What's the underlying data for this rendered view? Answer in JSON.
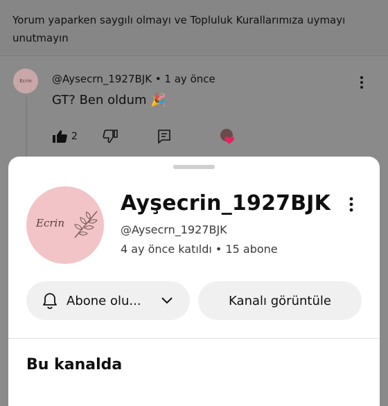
{
  "notice": {
    "text": "Yorum yaparken saygılı olmayı ve Topluluk Kurallarımıza uymayı unutmayın"
  },
  "comment": {
    "avatar_text": "Ecrin",
    "meta": "@Aysecrn_1927BJK • 1 ay önce",
    "text": "GT? Ben oldum 🎉",
    "like_count": "2",
    "icons": [
      "like-icon",
      "dislike-icon",
      "reply-icon",
      "creator-heart-icon",
      "more-vert-icon"
    ]
  },
  "sheet": {
    "avatar_text": "Ecrin",
    "title": "Ayşecrin_1927BJK",
    "handle": "@Aysecrn_1927BJK",
    "info": "4 ay önce katıldı • 15 abone",
    "subscribe_label": "Abone olu...",
    "view_channel_label": "Kanalı görüntüle",
    "section_title": "Bu kanalda"
  },
  "colors": {
    "overlay": "#8a8a8a",
    "sheet_bg": "#ffffff",
    "button_bg": "#f0f0f0",
    "avatar_pink": "#f2c4c7",
    "heart_red": "#e0245e"
  }
}
